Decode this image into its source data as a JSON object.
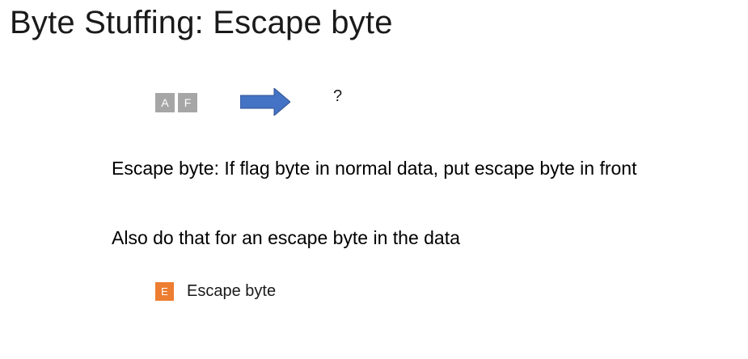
{
  "slide": {
    "title": "Byte Stuffing: Escape byte",
    "input_bytes": [
      "A",
      "F"
    ],
    "output_placeholder": "?",
    "paragraphs": [
      "Escape byte: If flag byte in normal data, put escape byte in front",
      "Also do that for an escape byte in the data"
    ],
    "legend": {
      "symbol": "E",
      "label": "Escape byte"
    }
  },
  "colors": {
    "data_byte": "#a6a6a6",
    "escape_byte": "#ed7d31",
    "arrow": "#4472c4"
  },
  "icons": {
    "arrow": "right-arrow-icon"
  }
}
